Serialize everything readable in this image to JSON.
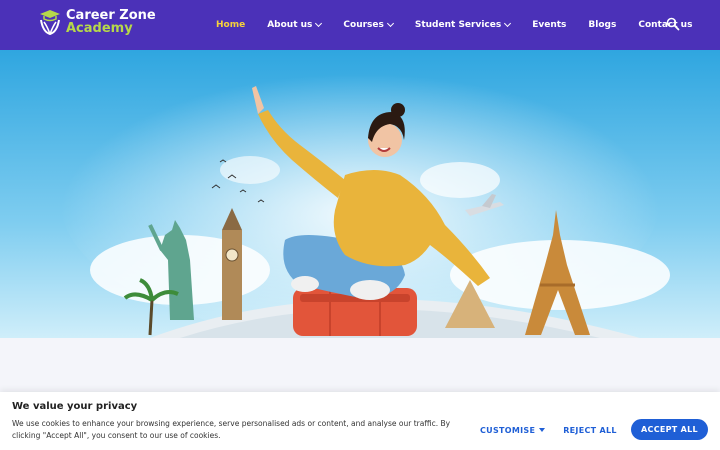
{
  "brand": {
    "name_line1": "Career Zone",
    "name_line2": "Academy"
  },
  "nav": {
    "items": [
      {
        "label": "Home",
        "active": true,
        "dropdown": false
      },
      {
        "label": "About us",
        "active": false,
        "dropdown": true
      },
      {
        "label": "Courses",
        "active": false,
        "dropdown": true
      },
      {
        "label": "Student Services",
        "active": false,
        "dropdown": true
      },
      {
        "label": "Events",
        "active": false,
        "dropdown": false
      },
      {
        "label": "Blogs",
        "active": false,
        "dropdown": false
      },
      {
        "label": "Contact us",
        "active": false,
        "dropdown": false
      }
    ],
    "search_icon": "search-icon"
  },
  "hero": {
    "image_alt": "Student with suitcase and world landmarks"
  },
  "cookie": {
    "title": "We value your privacy",
    "text": "We use cookies to enhance your browsing experience, serve personalised ads or content, and analyse our traffic. By clicking \"Accept All\", you consent to our use of cookies.",
    "customise_label": "CUSTOMISE",
    "reject_label": "REJECT ALL",
    "accept_label": "ACCEPT ALL"
  },
  "colors": {
    "header_bg": "#4b31b8",
    "active_nav": "#f7d23b",
    "brand_accent": "#b6d84a",
    "button_blue": "#1f5fd6"
  }
}
